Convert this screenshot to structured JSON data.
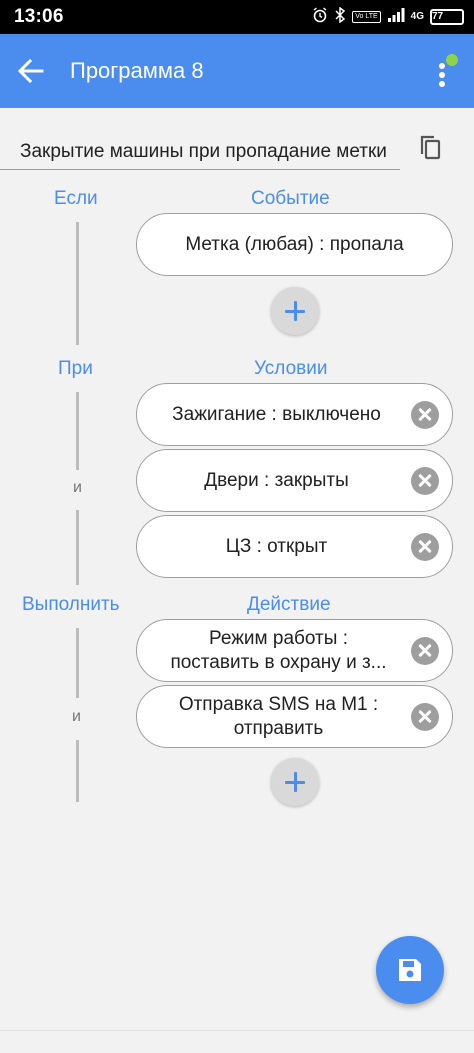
{
  "status_bar": {
    "time": "13:06",
    "icons": [
      "alarm-icon",
      "bluetooth-icon",
      "volte-icon",
      "signal-icon",
      "4g-icon",
      "battery-icon"
    ],
    "volte_label": "Vo LTE",
    "network_label": "4G",
    "battery_level": "77"
  },
  "app_bar": {
    "title": "Программа 8",
    "back_icon": "arrow-left-icon",
    "menu_icon": "more-vertical-icon",
    "background": "#4a8def",
    "notification_dot_color": "#8fd34a"
  },
  "program_name": {
    "value": "Закрытие машины при пропадание метки"
  },
  "trigger_section": {
    "side_label": "Если",
    "header": "Событие",
    "items": [
      {
        "label": "Метка (любая) : пропала"
      }
    ]
  },
  "condition_section": {
    "side_label": "При",
    "header": "Условии",
    "joiner": "и",
    "items": [
      {
        "label": "Зажигание : выключено"
      },
      {
        "label": "Двери : закрыты"
      },
      {
        "label": "ЦЗ : открыт"
      }
    ]
  },
  "action_section": {
    "side_label": "Выполнить",
    "header": "Действие",
    "joiner": "и",
    "items": [
      {
        "label_line1": "Режим работы :",
        "label_line2": "поставить в охрану и з..."
      },
      {
        "label_line1": "Отправка SMS на M1 :",
        "label_line2": "отправить"
      }
    ]
  },
  "fab": {
    "icon": "save-icon"
  },
  "colors": {
    "accent": "#4a8def",
    "pill_border": "#9e9e9e",
    "background": "#f2f2f2"
  }
}
